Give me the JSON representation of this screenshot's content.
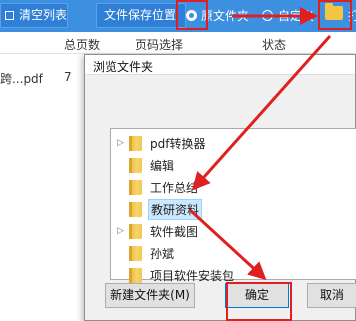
{
  "toolbar": {
    "clear_list": "清空列表",
    "save_location": "文件保存位置",
    "original_folder": "原文件夹",
    "custom": "自定义",
    "right_clip": "打"
  },
  "table": {
    "headers": [
      "总页数",
      "页码选择",
      "状态"
    ],
    "rows": [
      {
        "name": "跨...pdf",
        "pages": "7"
      }
    ]
  },
  "dialog": {
    "title": "浏览文件夹",
    "tree": [
      {
        "label": "pdf转换器",
        "expandable": true,
        "selected": false
      },
      {
        "label": "编辑",
        "expandable": false,
        "selected": false
      },
      {
        "label": "工作总结",
        "expandable": false,
        "selected": false
      },
      {
        "label": "教研资料",
        "expandable": false,
        "selected": true
      },
      {
        "label": "软件截图",
        "expandable": true,
        "selected": false
      },
      {
        "label": "孙斌",
        "expandable": false,
        "selected": false
      },
      {
        "label": "项目软件安装包",
        "expandable": false,
        "selected": false
      }
    ],
    "buttons": {
      "new_folder": "新建文件夹(M)",
      "ok": "确定",
      "cancel": "取消"
    }
  },
  "colors": {
    "toolbar": "#3d8fe0",
    "annotation": "#e02020",
    "selection": "#cce8ff"
  }
}
